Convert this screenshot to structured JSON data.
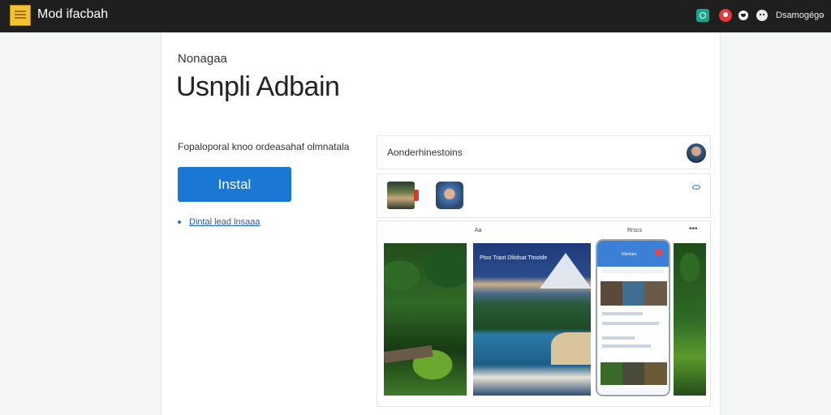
{
  "app": {
    "title": "Mod ifacbah",
    "user": "Dsamogégo"
  },
  "topbar": {
    "icons": [
      "app-logo-icon",
      "teal-app-icon",
      "notification-icon",
      "message-icon",
      "profile-face-icon",
      "chevron-down-icon"
    ],
    "chevron": "⌄"
  },
  "main": {
    "eyebrow": "Nonagaa",
    "headline": "Usnpli Adbain",
    "subtext": "Fopaloporal knoo ordeasahaf olmnatala",
    "install_label": "Instal",
    "link_text": "Dintal lead lnsaaa"
  },
  "preview": {
    "header_title": "Aonderhinestoins",
    "gallery_label_1": "Aa",
    "gallery_label_2": "Rrscs",
    "more": "•••",
    "beach_caption": "Ptoo Traot Dlitdsat Ttnotde",
    "phone_header_text": "Nlenlam"
  }
}
